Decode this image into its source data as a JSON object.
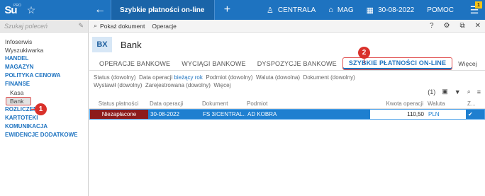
{
  "app": {
    "logo": "Su",
    "logo_sub": "PRO"
  },
  "topbar": {
    "tab_title": "Szybkie płatności on-line",
    "company": "CENTRALA",
    "warehouse": "MAG",
    "date": "30-08-2022",
    "help": "POMOC",
    "badge": "1"
  },
  "sidebar": {
    "search_placeholder": "Szukaj poleceń",
    "items": [
      {
        "label": "Infoserwis",
        "type": "plain"
      },
      {
        "label": "Wyszukiwarka",
        "type": "plain"
      },
      {
        "label": "HANDEL",
        "type": "hdr"
      },
      {
        "label": "MAGAZYN",
        "type": "hdr"
      },
      {
        "label": "POLITYKA CENOWA",
        "type": "hdr"
      },
      {
        "label": "FINANSE",
        "type": "hdr"
      },
      {
        "label": "Kasa",
        "type": "sub"
      },
      {
        "label": "Bank",
        "type": "sel"
      },
      {
        "label": "ROZLICZENIA",
        "type": "hdr"
      },
      {
        "label": "KARTOTEKI",
        "type": "hdr"
      },
      {
        "label": "KOMUNIKACJA",
        "type": "hdr"
      },
      {
        "label": "EWIDENCJE DODATKOWE",
        "type": "hdr"
      }
    ],
    "callout": "1"
  },
  "toolbar": {
    "show_doc": "Pokaż dokument",
    "operations": "Operacje"
  },
  "module": {
    "code": "BX",
    "title": "Bank"
  },
  "tabs": {
    "items": [
      "OPERACJE BANKOWE",
      "WYCIĄGI BANKOWE",
      "DYSPOZYCJE BANKOWE",
      "SZYBKIE PŁATNOŚCI ON-LINE"
    ],
    "more": "Więcej",
    "callout": "2"
  },
  "filters": {
    "status": "Status (dowolny)",
    "date_label": "Data operacji",
    "date_value": "bieżący rok",
    "subject": "Podmiot (dowolny)",
    "currency": "Waluta (dowolna)",
    "document": "Dokument (dowolny)",
    "issued": "Wystawił (dowolny)",
    "registered": "Zarejestrowana (dowolny)",
    "more": "Więcej",
    "count": "(1)"
  },
  "grid": {
    "headers": [
      "Status płatności",
      "Data operacji",
      "Dokument",
      "Podmiot",
      "Kwota operacji",
      "Waluta",
      "Z..."
    ],
    "rows": [
      [
        "Niezapłacone",
        "30-08-2022",
        "FS 3/CENTRAL...",
        "AD KOBRA",
        "110,50",
        "PLN",
        "✔"
      ]
    ]
  },
  "colors": {
    "accent": "#1e73c0",
    "callout": "#d9312b",
    "status_unpaid": "#8d1b1b"
  }
}
